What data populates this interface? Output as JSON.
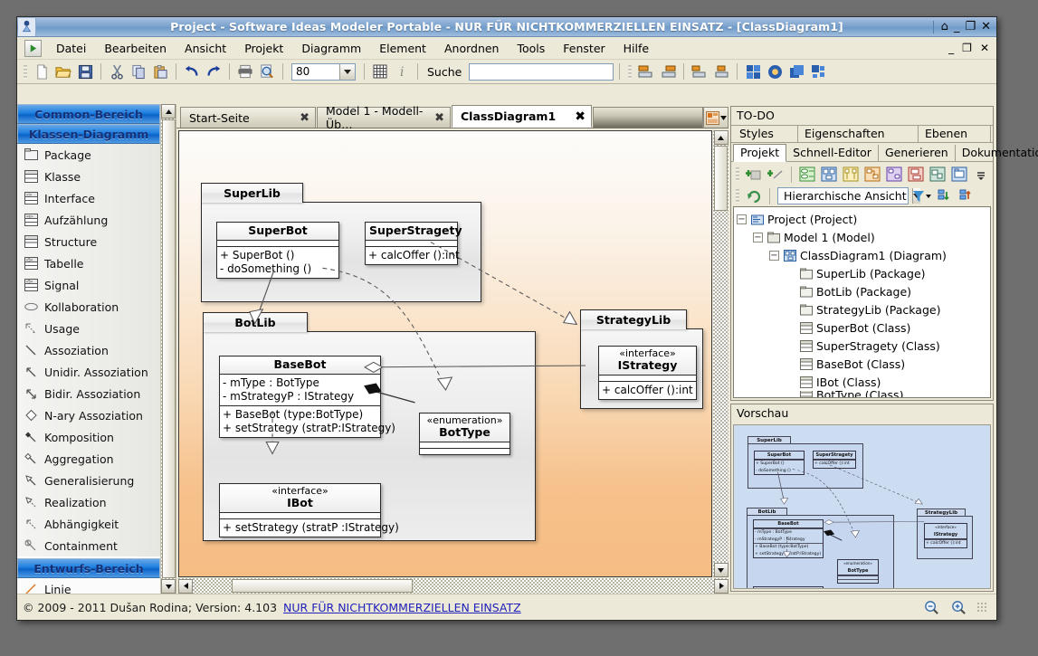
{
  "window": {
    "title": "Project - Software Ideas Modeler Portable - NUR FÜR NICHTKOMMERZIELLEN EINSATZ - [ClassDiagram1]",
    "restore_glyph": "⌂",
    "minimize_glyph": "_",
    "maximize_glyph": "❐",
    "close_glyph": "✕",
    "mdi_minimize": "_",
    "mdi_restore": "❐",
    "mdi_close": "✕"
  },
  "menu": {
    "items": [
      {
        "label": "Datei"
      },
      {
        "label": "Bearbeiten"
      },
      {
        "label": "Ansicht"
      },
      {
        "label": "Projekt"
      },
      {
        "label": "Diagramm"
      },
      {
        "label": "Element"
      },
      {
        "label": "Anordnen"
      },
      {
        "label": "Tools"
      },
      {
        "label": "Fenster"
      },
      {
        "label": "Hilfe"
      }
    ]
  },
  "toolbar": {
    "zoom_value": "80",
    "search_label": "Suche",
    "search_value": "",
    "search_placeholder": "",
    "icons": [
      "new-document-icon",
      "open-folder-icon",
      "save-icon",
      "cut-icon",
      "copy-icon",
      "paste-icon",
      "undo-icon",
      "redo-icon",
      "print-icon",
      "print-preview-icon",
      "grid-icon",
      "info-icon",
      "align-left-icon",
      "align-right-icon",
      "distribute-horizontal-icon",
      "distribute-vertical-icon",
      "layout-grid-icon",
      "style-icon",
      "layers-icon",
      "group-icon"
    ]
  },
  "toolbox": {
    "groups": [
      {
        "title": "Common-Bereich",
        "collapsed": true,
        "items": []
      },
      {
        "title": "Klassen-Diagramm",
        "collapsed": false,
        "items": [
          {
            "label": "Package",
            "icon": "package-icon"
          },
          {
            "label": "Klasse",
            "icon": "class-icon"
          },
          {
            "label": "Interface",
            "icon": "interface-icon"
          },
          {
            "label": "Aufzählung",
            "icon": "enumeration-icon"
          },
          {
            "label": "Structure",
            "icon": "structure-icon"
          },
          {
            "label": "Tabelle",
            "icon": "table-icon"
          },
          {
            "label": "Signal",
            "icon": "signal-icon"
          },
          {
            "label": "Kollaboration",
            "icon": "collaboration-icon"
          },
          {
            "label": "Usage",
            "icon": "usage-icon"
          },
          {
            "label": "Assoziation",
            "icon": "association-icon"
          },
          {
            "label": "Unidir. Assoziation",
            "icon": "unidirectional-association-icon"
          },
          {
            "label": "Bidir. Assoziation",
            "icon": "bidirectional-association-icon"
          },
          {
            "label": "N-ary Assoziation",
            "icon": "nary-association-icon"
          },
          {
            "label": "Komposition",
            "icon": "composition-icon"
          },
          {
            "label": "Aggregation",
            "icon": "aggregation-icon"
          },
          {
            "label": "Generalisierung",
            "icon": "generalization-icon"
          },
          {
            "label": "Realization",
            "icon": "realization-icon"
          },
          {
            "label": "Abhängigkeit",
            "icon": "dependency-icon"
          },
          {
            "label": "Containment",
            "icon": "containment-icon"
          }
        ]
      },
      {
        "title": "Entwurfs-Bereich",
        "collapsed": false,
        "items": [
          {
            "label": "Linie",
            "icon": "line-icon"
          }
        ]
      }
    ]
  },
  "editor": {
    "tabs": [
      {
        "label": "Start-Seite",
        "active": false,
        "close": "✖"
      },
      {
        "label": "Model 1 - Modell-Üb…",
        "active": false,
        "close": "✖"
      },
      {
        "label": "ClassDiagram1",
        "active": true,
        "close": "✖"
      }
    ],
    "tab_menu_icon": "tab-list-icon"
  },
  "diagram": {
    "packages": [
      {
        "name": "SuperLib"
      },
      {
        "name": "BotLib"
      },
      {
        "name": "StrategyLib"
      }
    ],
    "classes": [
      {
        "name": "SuperBot",
        "stereotype": "",
        "attributes": [],
        "operations": [
          "+ SuperBot ()",
          "- doSomething ()"
        ]
      },
      {
        "name": "SuperStragety",
        "stereotype": "",
        "attributes": [],
        "operations": [
          "+ calcOffer ():int"
        ]
      },
      {
        "name": "BaseBot",
        "stereotype": "",
        "attributes": [
          "- mType : BotType",
          "- mStrategyP : IStrategy"
        ],
        "operations": [
          "+ BaseBot (type:BotType)",
          "+ setStrategy (stratP:IStrategy)"
        ]
      },
      {
        "name": "BotType",
        "stereotype": "«enumeration»",
        "attributes": [],
        "operations": []
      },
      {
        "name": "IBot",
        "stereotype": "«interface»",
        "attributes": [],
        "operations": [
          "+ setStrategy (stratP :IStrategy)"
        ]
      },
      {
        "name": "IStrategy",
        "stereotype": "«interface»",
        "attributes": [],
        "operations": [
          "+ calcOffer ():int"
        ]
      }
    ]
  },
  "rightdock": {
    "todo": {
      "title": "TO-DO",
      "tabs_row1": [
        {
          "label": "Styles",
          "active": false
        },
        {
          "label": "Eigenschaften",
          "active": false
        },
        {
          "label": "Ebenen",
          "active": false
        }
      ],
      "tabs_row2": [
        {
          "label": "Projekt",
          "active": true
        },
        {
          "label": "Schnell-Editor",
          "active": false
        },
        {
          "label": "Generieren",
          "active": false
        },
        {
          "label": "Dokumentatio",
          "active": false
        }
      ],
      "toolbar_icons": [
        "add-element-icon",
        "add-relation-icon",
        "usecase-diagram-icon",
        "class-diagram-icon",
        "sequence-diagram-icon",
        "activity-diagram-icon",
        "state-diagram-icon",
        "component-diagram-icon",
        "deployment-diagram-icon",
        "package-diagram-icon",
        "more-icon"
      ],
      "view_refresh_icon": "refresh-icon",
      "view_mode": "Hierarchische Ansicht",
      "filter_icon": "filter-icon",
      "expand_icon": "expand-tree-icon",
      "collapse_icon": "collapse-tree-icon",
      "tree": [
        {
          "label": "Project (Project)",
          "depth": 0,
          "expander": "−",
          "icon": "project-icon"
        },
        {
          "label": "Model 1 (Model)",
          "depth": 1,
          "expander": "−",
          "icon": "model-icon"
        },
        {
          "label": "ClassDiagram1 (Diagram)",
          "depth": 2,
          "expander": "−",
          "icon": "diagram-icon"
        },
        {
          "label": "SuperLib (Package)",
          "depth": 3,
          "expander": "",
          "icon": "package-icon"
        },
        {
          "label": "BotLib (Package)",
          "depth": 3,
          "expander": "",
          "icon": "package-icon"
        },
        {
          "label": "StrategyLib (Package)",
          "depth": 3,
          "expander": "",
          "icon": "package-icon"
        },
        {
          "label": "SuperBot (Class)",
          "depth": 3,
          "expander": "",
          "icon": "class-icon"
        },
        {
          "label": "SuperStragety (Class)",
          "depth": 3,
          "expander": "",
          "icon": "class-icon"
        },
        {
          "label": "BaseBot (Class)",
          "depth": 3,
          "expander": "",
          "icon": "class-icon"
        },
        {
          "label": "IBot (Class)",
          "depth": 3,
          "expander": "",
          "icon": "class-icon"
        },
        {
          "label": "BotType (Class)",
          "depth": 3,
          "expander": "",
          "icon": "class-icon"
        }
      ]
    },
    "preview": {
      "title": "Vorschau"
    }
  },
  "status": {
    "copyright": "© 2009 - 2011 Dušan Rodina; Version: 4.103",
    "link": "NUR FÜR NICHTKOMMERZIELLEN EINSATZ",
    "zoom_out_icon": "zoom-out-icon",
    "zoom_in_icon": "zoom-in-icon"
  }
}
